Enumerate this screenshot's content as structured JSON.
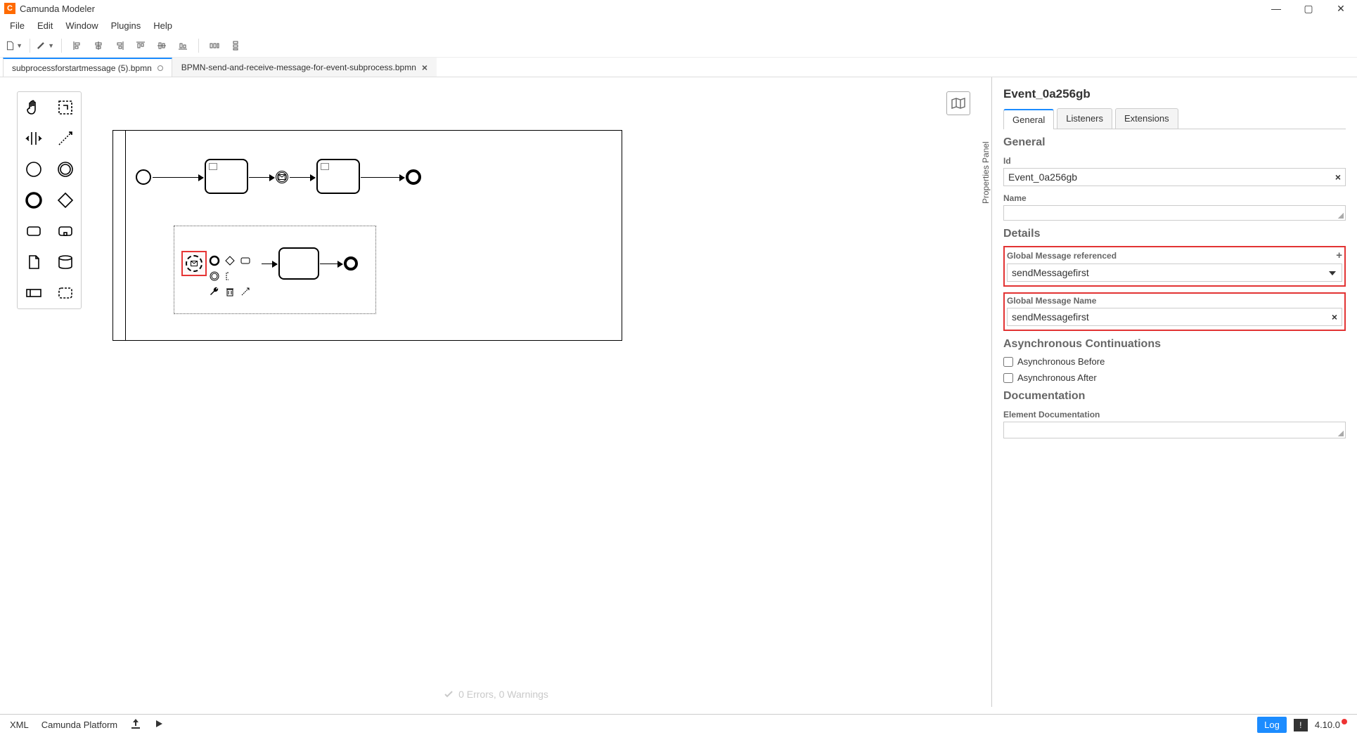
{
  "app": {
    "title": "Camunda Modeler"
  },
  "menu": [
    "File",
    "Edit",
    "Window",
    "Plugins",
    "Help"
  ],
  "tabs": [
    {
      "label": "subprocessforstartmessage (5).bpmn",
      "active": true,
      "dirty": true
    },
    {
      "label": "BPMN-send-and-receive-message-for-event-subprocess.bpmn",
      "active": false,
      "closable": true
    }
  ],
  "errors": {
    "text": "0 Errors, 0 Warnings"
  },
  "prop": {
    "header": "Event_0a256gb",
    "tabs": [
      "General",
      "Listeners",
      "Extensions"
    ],
    "section_general": "General",
    "id_label": "Id",
    "id_value": "Event_0a256gb",
    "name_label": "Name",
    "name_value": "",
    "section_details": "Details",
    "msgref_label": "Global Message referenced",
    "msgref_value": "sendMessagefirst",
    "msgname_label": "Global Message Name",
    "msgname_value": "sendMessagefirst",
    "section_async": "Asynchronous Continuations",
    "async_before": "Asynchronous Before",
    "async_after": "Asynchronous After",
    "section_doc": "Documentation",
    "doc_label": "Element Documentation",
    "doc_value": "",
    "vertical_label": "Properties Panel"
  },
  "footer": {
    "xml": "XML",
    "platform": "Camunda Platform",
    "log": "Log",
    "version": "4.10.0"
  }
}
